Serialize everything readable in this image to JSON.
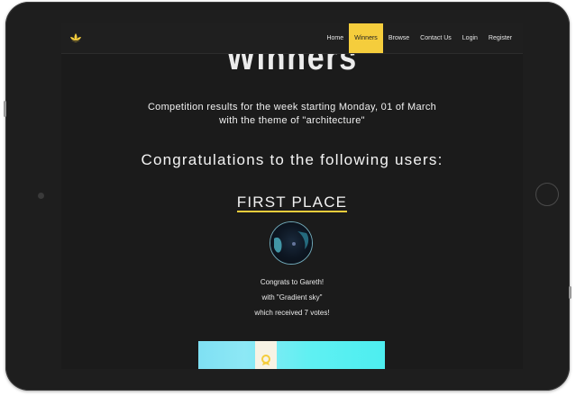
{
  "nav": {
    "items": [
      {
        "label": "Home",
        "active": false
      },
      {
        "label": "Winners",
        "active": true
      },
      {
        "label": "Browse",
        "active": false
      },
      {
        "label": "Contact Us",
        "active": false
      },
      {
        "label": "Login",
        "active": false
      },
      {
        "label": "Register",
        "active": false
      }
    ]
  },
  "hero": {
    "title": "Winners"
  },
  "intro": {
    "text": "Competition results for the week starting Monday, 01 of March with the theme of \"architecture\""
  },
  "congrats": {
    "heading": "Congratulations to the following users:"
  },
  "first_place": {
    "heading": "FIRST PLACE",
    "line1": "Congrats to Gareth!",
    "line2": "with \"Gradient sky\"",
    "line3": "which received 7 votes!"
  },
  "colors": {
    "accent": "#f5cd3c",
    "background": "#1b1b1b",
    "text": "#f0f0f0"
  },
  "icons": [
    "lotus-logo-icon",
    "medal-icon"
  ]
}
